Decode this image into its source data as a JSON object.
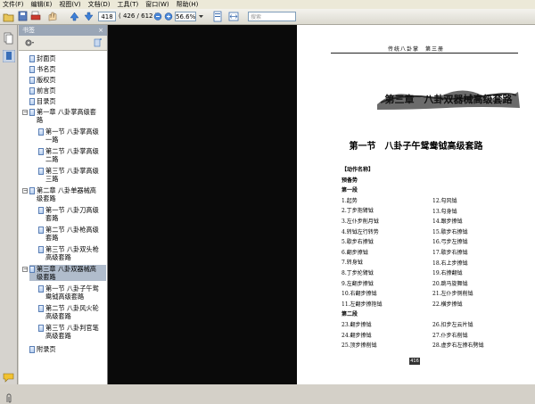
{
  "menu": [
    "文件(F)",
    "编辑(E)",
    "视图(V)",
    "文档(D)",
    "工具(T)",
    "窗口(W)",
    "帮助(H)"
  ],
  "toolbar": {
    "page_current": "418",
    "page_count": "( 426 / 612 )",
    "zoom": "56.6%",
    "search_placeholder": "搜索"
  },
  "panel": {
    "title": "书签",
    "close": "×"
  },
  "bookmarks": [
    {
      "label": "封面页"
    },
    {
      "label": "书名页"
    },
    {
      "label": "版权页"
    },
    {
      "label": "前言页"
    },
    {
      "label": "目录页"
    },
    {
      "label": "第一章 八卦掌高级套\n路"
    },
    {
      "label": "第一节 八卦掌高级\n一路"
    },
    {
      "label": "第二节 八卦掌高级\n二路"
    },
    {
      "label": "第三节 八卦掌高级\n三路"
    },
    {
      "label": "第二章 八卦单器械高\n级套路"
    },
    {
      "label": "第一节 八卦刀高级\n套路"
    },
    {
      "label": "第二节 八卦枪高级\n套路"
    },
    {
      "label": "第三节 八卦双头枪\n高级套路"
    },
    {
      "label": "第三章 八卦双器械高\n级套路"
    },
    {
      "label": "第一节 八卦子午鸳\n鸯钺高级套路"
    },
    {
      "label": "第二节 八卦风火轮\n高级套路"
    },
    {
      "label": "第三节 八卦判官笔\n高级套路"
    },
    {
      "label": "附录页"
    }
  ],
  "doc": {
    "running_head": "传统八卦掌　第三册",
    "banner": "第三章　八卦双器械高级套路",
    "section_title": "第一节　八卦子午鸳鸯钺高级套路",
    "left_col": [
      "【动作名称】",
      "预备势",
      "第一段",
      "1.起势",
      "2.丁步抱臂钺",
      "3.左仆步削月钺",
      "4.转钺左行转势",
      "5.歇步右撩钺",
      "6.翻步撩钺",
      "7.转身钺",
      "8.丁步抡臂钺",
      "9.左翻步撩钺",
      "10.右翻步撩钺",
      "11.左翻步撩抱钺",
      "第二段",
      "23.翻步撩钺",
      "24.翻步撩钺",
      "25.顶步撩削钺"
    ],
    "right_col": [
      "12.勾风钺",
      "13.勾身钺",
      "14.跟步撩钺",
      "15.歇步右撩钺",
      "16.弓步左撩钺",
      "17.歇步右撩钺",
      "18.右上步撩钺",
      "19.右撩翻钺",
      "20.跳马旋舞钺",
      "21.左仆步侧削钺",
      "22.横步撩钺",
      "26.扣步左云片钺",
      "27.仆步右削钺",
      "28.虚步右左撩右劈钺"
    ],
    "page_number": "416"
  },
  "colors": {
    "panel_header": "#9aa6b6",
    "selected": "#b0bccc",
    "gutter": "#0a0a0a"
  }
}
